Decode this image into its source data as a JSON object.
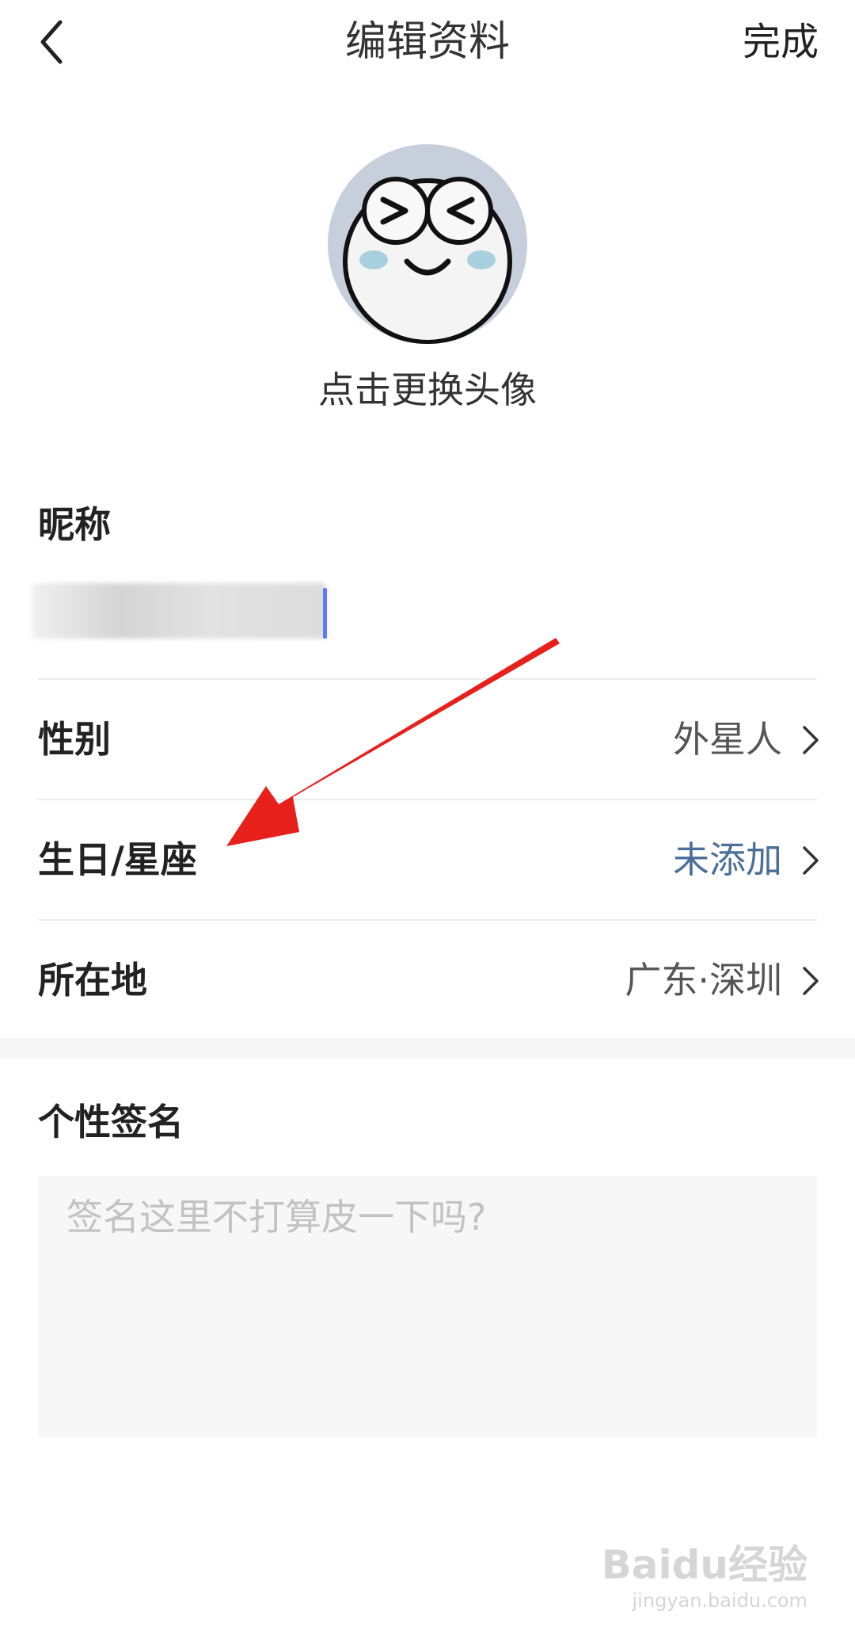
{
  "header": {
    "title": "编辑资料",
    "done_label": "完成"
  },
  "avatar": {
    "hint": "点击更换头像"
  },
  "nickname": {
    "label": "昵称",
    "value": ""
  },
  "rows": [
    {
      "label": "性别",
      "value": "外星人"
    },
    {
      "label": "生日/星座",
      "value": "未添加"
    },
    {
      "label": "所在地",
      "value": "广东·深圳"
    }
  ],
  "signature": {
    "label": "个性签名",
    "placeholder": "签名这里不打算皮一下吗?"
  },
  "watermark": {
    "main": "Baidu经验",
    "sub": "jingyan.baidu.com"
  },
  "colors": {
    "accent": "#4a6f9a",
    "caret": "#5b7cf5",
    "annotation_arrow": "#e8201c"
  }
}
